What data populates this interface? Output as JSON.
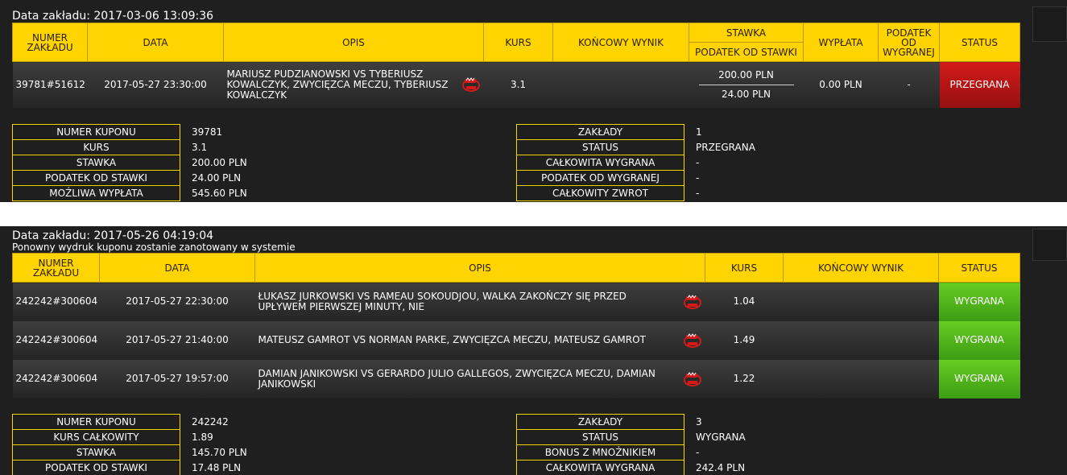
{
  "bet1": {
    "date_label": "Data zakładu: 2017-03-06 13:09:36",
    "headers": {
      "number": "NUMER ZAKŁADU",
      "date": "DATA",
      "desc": "OPIS",
      "odds": "KURS",
      "final": "KOŃCOWY WYNIK",
      "stake": "STAWKA",
      "stake_tax": "PODATEK OD STAWKI",
      "payout": "WYPŁATA",
      "win_tax": "PODATEK OD WYGRANEJ",
      "status": "STATUS"
    },
    "row": {
      "number": "39781#51612",
      "date": "2017-05-27 23:30:00",
      "desc": "MARIUSZ PUDZIANOWSKI VS TYBERIUSZ KOWALCZYK, ZWYCIĘZCA MECZU, TYBERIUSZ KOWALCZYK",
      "odds": "3.1",
      "final": "",
      "stake": "200.00 PLN",
      "stake_tax": "24.00 PLN",
      "payout": "0.00 PLN",
      "win_tax": "-",
      "status": "PRZEGRANA"
    },
    "summary_left": [
      {
        "k": "NUMER KUPONU",
        "v": "39781"
      },
      {
        "k": "KURS",
        "v": "3.1"
      },
      {
        "k": "STAWKA",
        "v": "200.00 PLN"
      },
      {
        "k": "PODATEK OD STAWKI",
        "v": "24.00 PLN"
      },
      {
        "k": "MOŻLIWA WYPŁATA",
        "v": "545.60 PLN"
      }
    ],
    "summary_right": [
      {
        "k": "ZAKŁADY",
        "v": "1"
      },
      {
        "k": "STATUS",
        "v": "PRZEGRANA"
      },
      {
        "k": "CAŁKOWITA WYGRANA",
        "v": "-"
      },
      {
        "k": "PODATEK OD WYGRANEJ",
        "v": "-"
      },
      {
        "k": "CAŁKOWITY ZWROT",
        "v": "-"
      }
    ]
  },
  "bet2": {
    "date_label": "Data zakładu: 2017-05-26 04:19:04",
    "reprint_note": "Ponowny wydruk kuponu zostanie zanotowany w systemie",
    "headers": {
      "number": "NUMER ZAKŁADU",
      "date": "DATA",
      "desc": "OPIS",
      "odds": "KURS",
      "final": "KOŃCOWY WYNIK",
      "status": "STATUS"
    },
    "rows": [
      {
        "number": "242242#300604",
        "date": "2017-05-27 22:30:00",
        "desc": "ŁUKASZ JURKOWSKI VS RAMEAU SOKOUDJOU, WALKA ZAKOŃCZY SIĘ PRZED UPŁYWEM PIERWSZEJ MINUTY, NIE",
        "odds": "1.04",
        "final": "",
        "status": "WYGRANA"
      },
      {
        "number": "242242#300604",
        "date": "2017-05-27 21:40:00",
        "desc": "MATEUSZ GAMROT VS NORMAN PARKE, ZWYCIĘZCA MECZU, MATEUSZ GAMROT",
        "odds": "1.49",
        "final": "",
        "status": "WYGRANA"
      },
      {
        "number": "242242#300604",
        "date": "2017-05-27 19:57:00",
        "desc": "DAMIAN JANIKOWSKI VS GERARDO JULIO GALLEGOS, ZWYCIĘZCA MECZU, DAMIAN JANIKOWSKI",
        "odds": "1.22",
        "final": "",
        "status": "WYGRANA"
      }
    ],
    "summary_left": [
      {
        "k": "NUMER KUPONU",
        "v": "242242"
      },
      {
        "k": "KURS CAŁKOWITY",
        "v": "1.89"
      },
      {
        "k": "STAWKA",
        "v": "145.70 PLN"
      },
      {
        "k": "PODATEK OD STAWKI",
        "v": "17.48 PLN"
      }
    ],
    "summary_right": [
      {
        "k": "ZAKŁADY",
        "v": "3"
      },
      {
        "k": "STATUS",
        "v": "WYGRANA"
      },
      {
        "k": "BONUS Z MNOŻNIKIEM",
        "v": "-"
      },
      {
        "k": "CAŁKOWITA WYGRANA",
        "v": "242.4 PLN"
      }
    ]
  },
  "colors": {
    "header_yellow": "#ffd400",
    "lost_red": "#c01515",
    "won_green": "#55b51c",
    "background": "#1f1f1f"
  },
  "icons": {
    "event_icon": "boxing-glove-icon"
  }
}
